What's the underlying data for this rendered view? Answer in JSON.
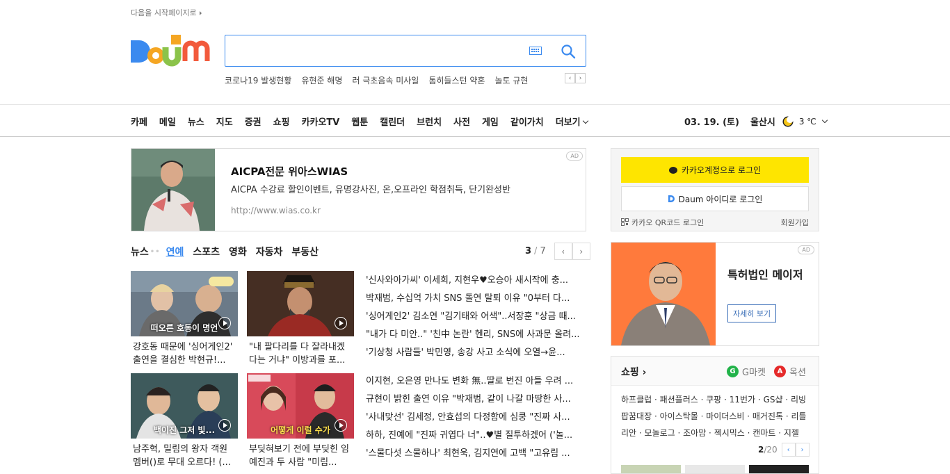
{
  "top": {
    "start_page_link": "다음을 시작페이지로"
  },
  "search": {
    "placeholder": "",
    "trends": [
      "코로나19 발생현황",
      "유현준 해명",
      "러 극초음속 미사일",
      "톰히들스턴 약혼",
      "놀토 규현"
    ]
  },
  "gnb": {
    "items": [
      "카페",
      "메일",
      "뉴스",
      "지도",
      "증권",
      "쇼핑",
      "카카오TV",
      "웹툰",
      "캘린더",
      "브런치",
      "사전",
      "게임",
      "같이가치",
      "더보기"
    ],
    "date": "03. 19. (토)",
    "city": "울산시",
    "temp": "3 ℃"
  },
  "ad_banner": {
    "badge": "AD",
    "title": "AICPA전문 위아스WIAS",
    "desc": "AICPA 수강료 할인이벤트, 유명강사진, 온,오프라인 학점취득, 단기완성반",
    "url": "http://www.wias.co.kr"
  },
  "news": {
    "label": "뉴스",
    "tabs": [
      "연예",
      "스포츠",
      "영화",
      "자동차",
      "부동산"
    ],
    "page_current": "3",
    "page_sep": "/",
    "page_total": "7",
    "cards": [
      {
        "caption": "떠오른 호동이 명언",
        "title": "강호동 때문에 '싱어게인2' 출연을 결심한 박현규!..."
      },
      {
        "caption": "",
        "title": "\"내 팔다리를 다 잘라내겠다는 거냐\" 이방과를 포..."
      },
      {
        "caption": "백이진 그저 빛...",
        "title": "남주혁, 밀림의 왕자 객원멤버()로 무대 오르다! (..."
      },
      {
        "caption": "어떻게 이럴 수가",
        "title": "부딪혀보기 전에 부딪힌 임예진과 두 사람 \"미림..."
      }
    ],
    "headlines": [
      "'신사와아가씨' 이세희, 지현우♥오승아 새시작에 충...",
      "박재범, 수십억 가치 SNS 돌연 탈퇴 이유 \"0부터 다...",
      "'싱어게인2' 김소연 \"김기태와 어색\"..서장훈 \"상금 때...",
      "\"내가 다 미안..\" '친中 논란' 헨리, SNS에 사과문 올려...",
      "'기상청 사람들' 박민영, 송강 사고 소식에 오열→윤...",
      "이지현, 오은영 만나도 변화 無..딸로 번진 아들 우려 ...",
      "규현이 밝힌 출연 이유 \"박재범, 같이 나갈 마땅한 사...",
      "'사내맞선' 김세정, 안효섭의 다정함에 심쿵 \"진짜 사...",
      "하하, 진예에 \"진짜 귀엽다 너\"..♥별 질투하겠어 ('놀...",
      "'스물다섯 스물하나' 최현욱, 김지연에 고백 \"고유림 ..."
    ]
  },
  "login": {
    "kakao_label": "카카오계정으로 로그인",
    "daum_label": "Daum 아이디로 로그인",
    "qr_label": "카카오 QR코드 로그인",
    "signup_label": "회원가입"
  },
  "ad_side": {
    "badge": "AD",
    "title": "특허법인 메이저",
    "button": "자세히 보기"
  },
  "shopping": {
    "title": "쇼핑",
    "gmarket": "G마켓",
    "auction": "옥션",
    "links": "하프클럽 · 패션플러스 · 쿠팡 · 11번가 · GS샵 · 리빙팝꿈대장 · 아이스탁몰 · 마이더스비 · 매거진톡 · 리틀리안 · 모놀로그 · 조아맘 · 젝시믹스 · 캔마트 · 지젤",
    "page_current": "2",
    "page_total": "/20"
  },
  "colors": {
    "accent": "#3b8aef",
    "kakao": "#fee500"
  }
}
